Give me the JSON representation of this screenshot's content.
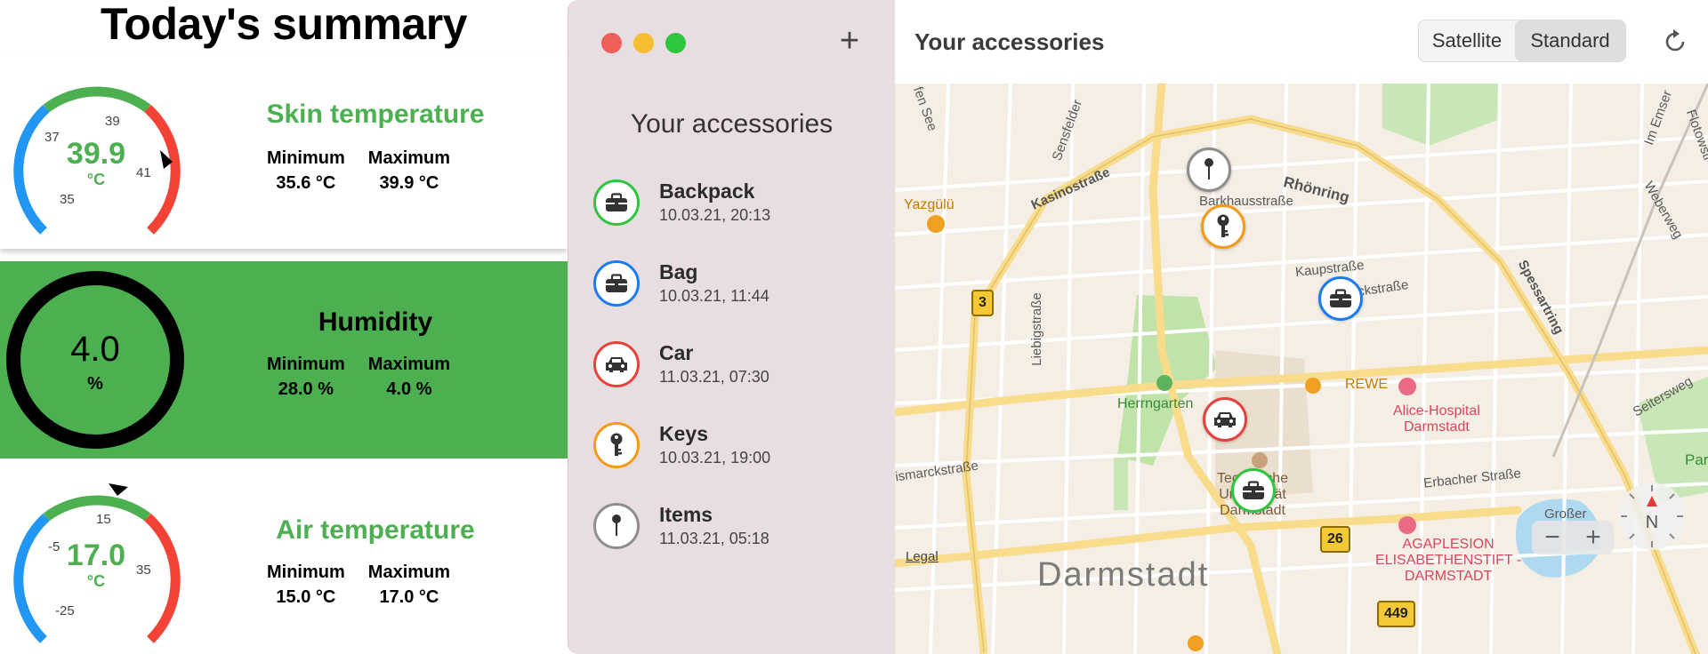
{
  "summary": {
    "title": "Today's summary",
    "skin": {
      "label": "Skin temperature",
      "value": "39.9",
      "unit": "°C",
      "ticks": [
        "35",
        "37",
        "39",
        "41"
      ],
      "min_label": "Minimum",
      "min_value": "35.6 °C",
      "max_label": "Maximum",
      "max_value": "39.9 °C",
      "color": "#4caf50"
    },
    "humidity": {
      "label": "Humidity",
      "value": "4.0",
      "unit": "%",
      "min_label": "Minimum",
      "min_value": "28.0 %",
      "max_label": "Maximum",
      "max_value": "4.0 %",
      "color": "#4caf50"
    },
    "air": {
      "label": "Air temperature",
      "value": "17.0",
      "unit": "°C",
      "ticks": [
        "-25",
        "-5",
        "15",
        "35"
      ],
      "min_label": "Minimum",
      "min_value": "15.0 °C",
      "max_label": "Maximum",
      "max_value": "17.0 °C",
      "color": "#4caf50"
    }
  },
  "sidebar": {
    "add_label": "+",
    "title": "Your accessories",
    "items": [
      {
        "name": "Backpack",
        "date": "10.03.21, 20:13",
        "icon": "briefcase-icon",
        "color": "#2ec53f"
      },
      {
        "name": "Bag",
        "date": "10.03.21, 11:44",
        "icon": "briefcase-icon",
        "color": "#1a7cf0"
      },
      {
        "name": "Car",
        "date": "11.03.21, 07:30",
        "icon": "car-icon",
        "color": "#e8413b"
      },
      {
        "name": "Keys",
        "date": "10.03.21, 19:00",
        "icon": "key-icon",
        "color": "#f59a17"
      },
      {
        "name": "Items",
        "date": "11.03.21, 05:18",
        "icon": "pin-icon",
        "color": "#8e8e8e"
      }
    ]
  },
  "map": {
    "title": "Your accessories",
    "satellite_label": "Satellite",
    "standard_label": "Standard",
    "selected_mode": "Standard",
    "legal_label": "Legal",
    "city_label": "Darmstadt",
    "compass_label": "N",
    "zoom_out_label": "−",
    "zoom_in_label": "+",
    "labels": {
      "yazgulu": "Yazgülü",
      "kasino": "Kasinostraße",
      "barkhaus": "Barkhausstraße",
      "rhoenring": "Rhönring",
      "kaup": "Kaupstraße",
      "ckstrasse": "ckstraße",
      "spessart": "Spessartring",
      "herrngarten": "Herrngarten",
      "rewe": "REWE",
      "alice": "Alice-Hospital\nDarmstadt",
      "liebig": "Liebigstraße",
      "bismarck": "ismarckstraße",
      "tu": "Technische\nUniversität\nDarmstadt",
      "erbacher": "Erbacher Straße",
      "agaplesion": "AGAPLESION\nELISABETHENSTIFT -\nDARMSTADT",
      "park": "Park",
      "sensfelder": "Sensfelder",
      "seiters": "Seitersweg",
      "weber": "Weberweg",
      "imemser": "Im Emser",
      "flotow": "Flotowstr",
      "fen_see": "fen See",
      "gross": "Großer"
    },
    "shields": [
      "3",
      "26",
      "449"
    ]
  }
}
